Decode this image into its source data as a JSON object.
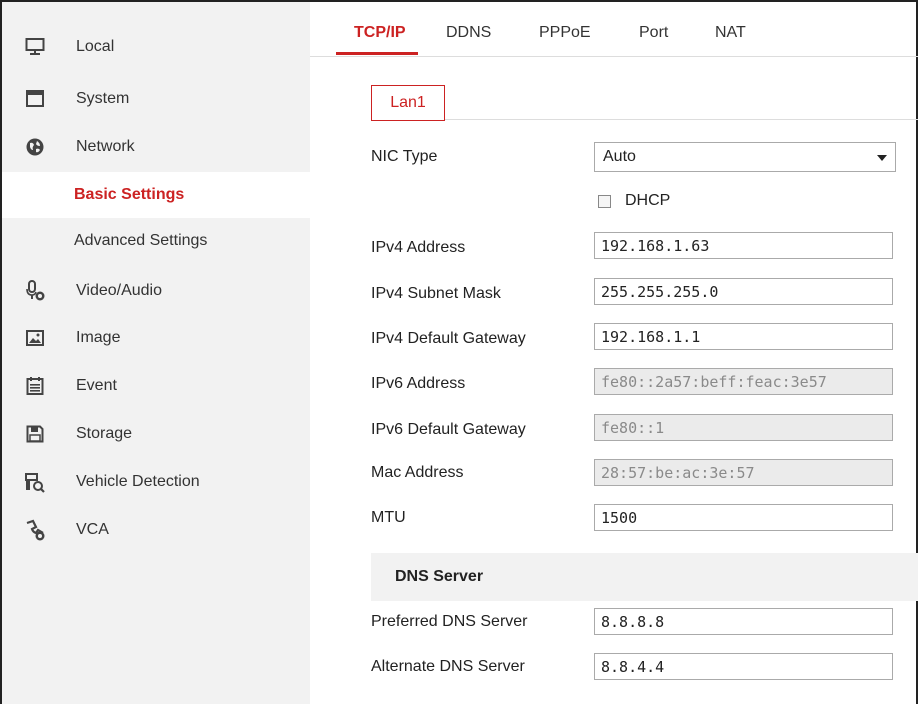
{
  "sidebar": {
    "items": [
      {
        "label": "Local",
        "icon": "monitor-icon"
      },
      {
        "label": "System",
        "icon": "window-icon"
      },
      {
        "label": "Network",
        "icon": "globe-icon"
      },
      {
        "label": "Basic Settings",
        "active": true
      },
      {
        "label": "Advanced Settings"
      },
      {
        "label": "Video/Audio",
        "icon": "microphone-camera-icon"
      },
      {
        "label": "Image",
        "icon": "image-icon"
      },
      {
        "label": "Event",
        "icon": "calendar-icon"
      },
      {
        "label": "Storage",
        "icon": "floppy-disk-icon"
      },
      {
        "label": "Vehicle Detection",
        "icon": "vehicle-search-icon"
      },
      {
        "label": "VCA",
        "icon": "vca-icon"
      }
    ]
  },
  "tabs": [
    {
      "label": "TCP/IP",
      "active": true
    },
    {
      "label": "DDNS"
    },
    {
      "label": "PPPoE"
    },
    {
      "label": "Port"
    },
    {
      "label": "NAT"
    }
  ],
  "lan_tab": "Lan1",
  "form": {
    "nic_type_label": "NIC Type",
    "nic_type_value": "Auto",
    "dhcp_label": "DHCP",
    "ipv4_address_label": "IPv4 Address",
    "ipv4_address": "192.168.1.63",
    "ipv4_mask_label": "IPv4 Subnet Mask",
    "ipv4_mask": "255.255.255.0",
    "ipv4_gateway_label": "IPv4 Default Gateway",
    "ipv4_gateway": "192.168.1.1",
    "ipv6_address_label": "IPv6 Address",
    "ipv6_address": "fe80::2a57:beff:feac:3e57",
    "ipv6_gateway_label": "IPv6 Default Gateway",
    "ipv6_gateway": "fe80::1",
    "mac_label": "Mac Address",
    "mac": "28:57:be:ac:3e:57",
    "mtu_label": "MTU",
    "mtu": "1500",
    "dns_header": "DNS Server",
    "preferred_dns_label": "Preferred DNS Server",
    "preferred_dns": "8.8.8.8",
    "alternate_dns_label": "Alternate DNS Server",
    "alternate_dns": "8.8.4.4"
  },
  "colors": {
    "accent": "#cc2222",
    "sidebar_bg": "#f2f2f2"
  }
}
